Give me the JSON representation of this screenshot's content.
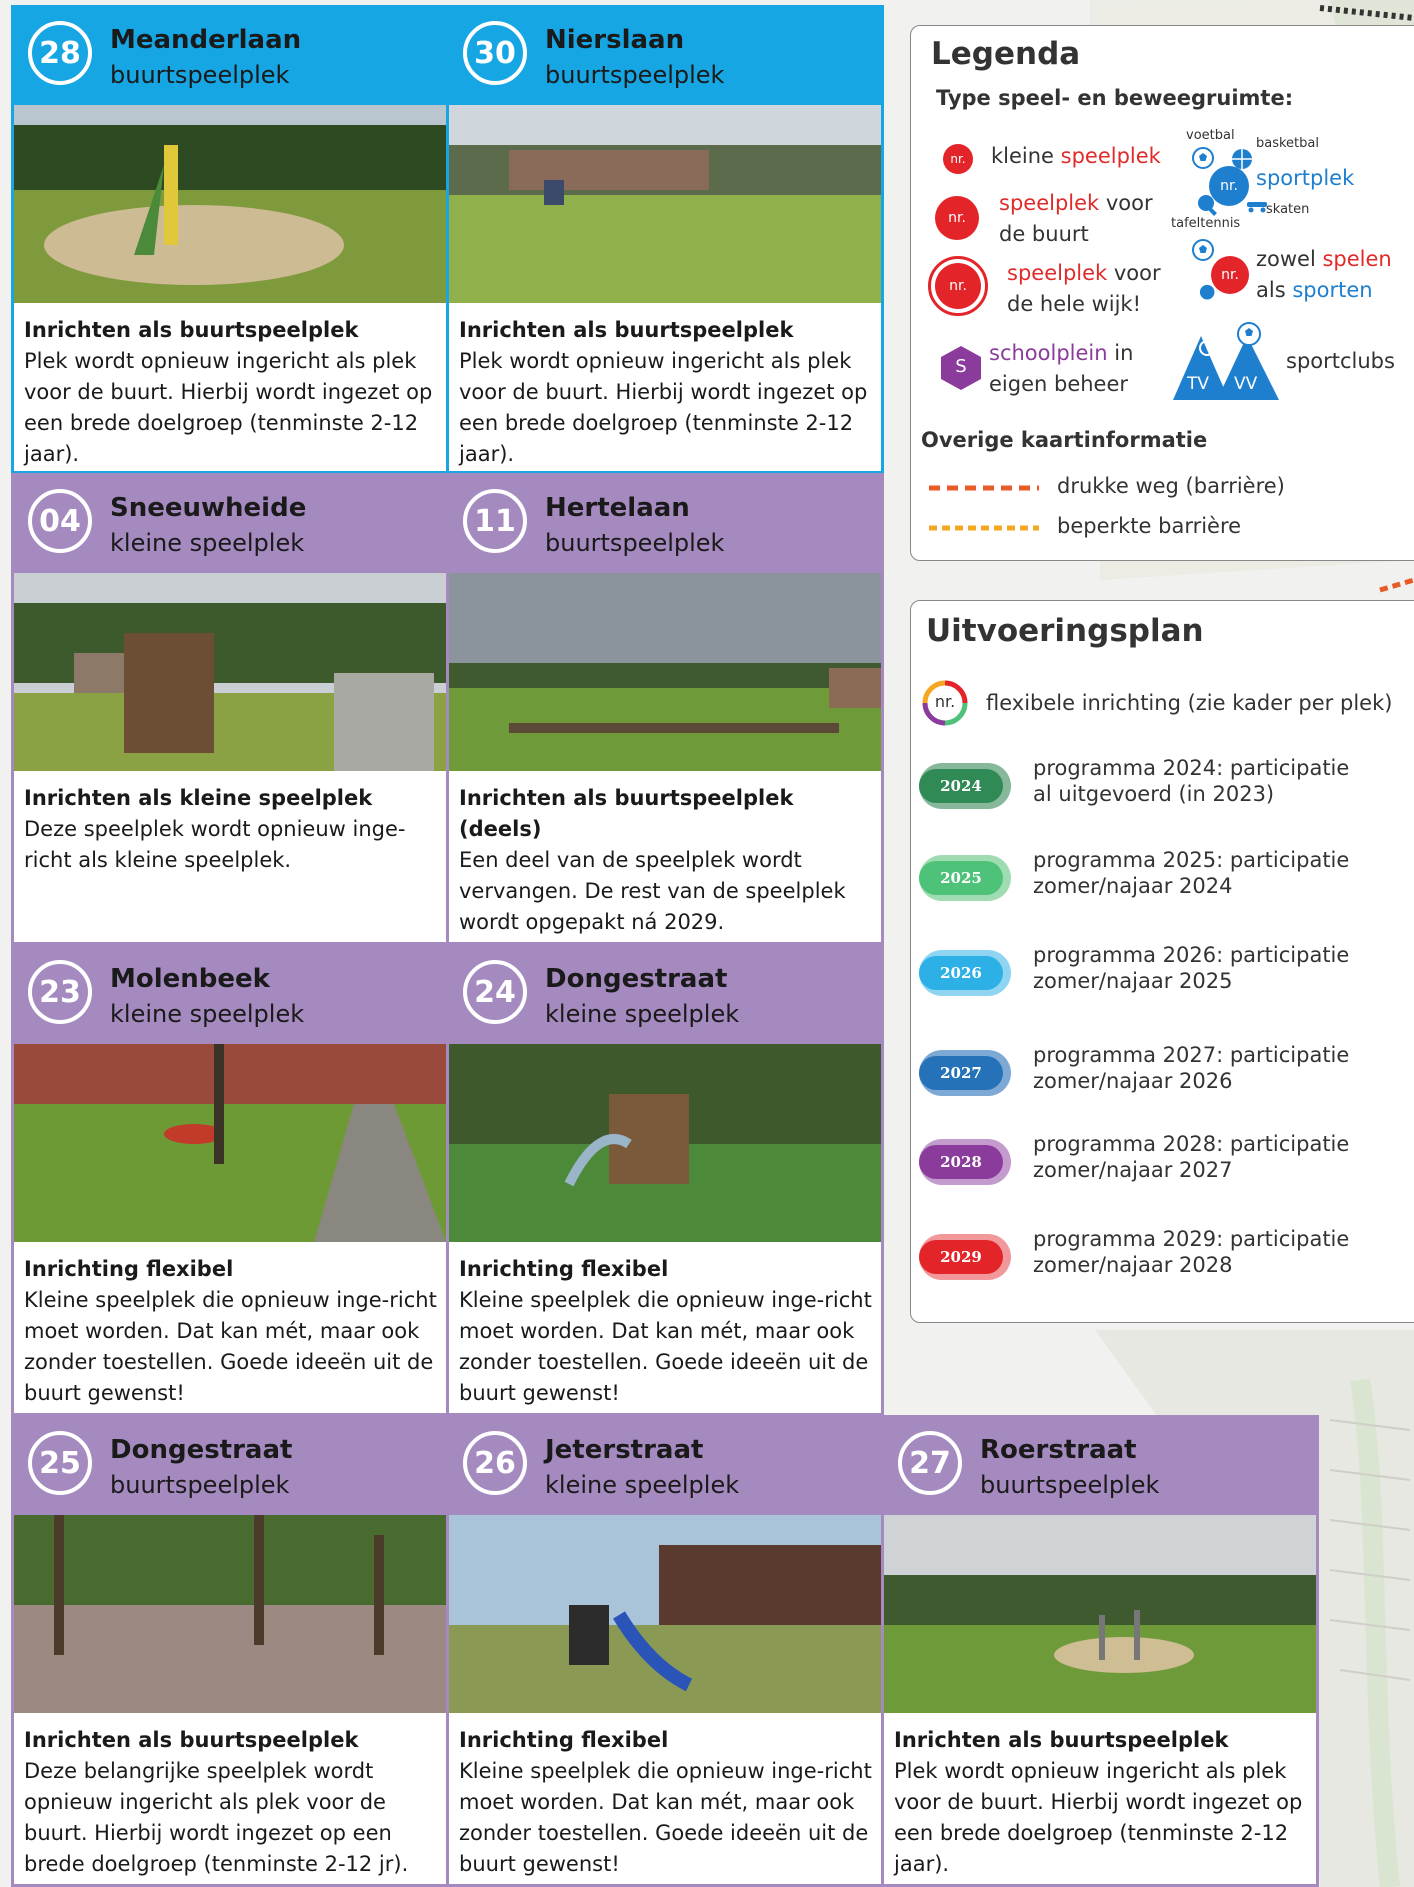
{
  "cards": [
    {
      "num": "28",
      "name": "Meanderlaan",
      "type": "buurtspeelplek",
      "heading": "Inrichten als buurtspeelplek",
      "body": "Plek wordt opnieuw ingericht als plek voor de buurt. Hierbij wordt ingezet op een brede doelgroep (tenminste 2-12 jaar)."
    },
    {
      "num": "30",
      "name": "Nierslaan",
      "type": "buurtspeelplek",
      "heading": "Inrichten als buurtspeelplek",
      "body": "Plek wordt opnieuw ingericht als plek voor de buurt. Hierbij wordt ingezet op een brede doelgroep (tenminste 2-12 jaar)."
    },
    {
      "num": "04",
      "name": "Sneeuwheide",
      "type": "kleine speelplek",
      "heading": "Inrichten als kleine speelplek",
      "body": "Deze speelplek wordt opnieuw inge-richt als kleine speelplek."
    },
    {
      "num": "11",
      "name": "Hertelaan",
      "type": "buurtspeelplek",
      "heading": "Inrichten als buurtspeelplek (deels)",
      "body": "Een deel van de speelplek wordt vervangen. De rest van de speelplek wordt opgepakt ná 2029."
    },
    {
      "num": "23",
      "name": "Molenbeek",
      "type": "kleine speelplek",
      "heading": "Inrichting flexibel",
      "body": "Kleine speelplek die opnieuw inge-richt moet worden. Dat kan mét, maar ook zonder toestellen. Goede ideeën uit de buurt gewenst!"
    },
    {
      "num": "24",
      "name": "Dongestraat",
      "type": "kleine speelplek",
      "heading": "Inrichting flexibel",
      "body": "Kleine speelplek die opnieuw inge-richt moet worden. Dat kan mét, maar ook zonder toestellen. Goede ideeën uit de buurt gewenst!"
    },
    {
      "num": "25",
      "name": "Dongestraat",
      "type": "buurtspeelplek",
      "heading": "Inrichten als buurtspeelplek",
      "body": "Deze belangrijke speelplek wordt opnieuw ingericht als plek voor de buurt. Hierbij wordt ingezet op een brede doelgroep (tenminste 2-12 jr)."
    },
    {
      "num": "26",
      "name": "Jeterstraat",
      "type": "kleine speelplek",
      "heading": "Inrichting flexibel",
      "body": "Kleine speelplek die opnieuw inge-richt moet worden. Dat kan mét, maar ook zonder toestellen. Goede ideeën uit de buurt gewenst!"
    },
    {
      "num": "27",
      "name": "Roerstraat",
      "type": "buurtspeelplek",
      "heading": "Inrichten als buurtspeelplek",
      "body": "Plek wordt opnieuw ingericht als plek voor de buurt. Hierbij wordt ingezet op een brede doelgroep (tenminste 2-12 jaar)."
    }
  ],
  "colors": {
    "blue": "#16a6e4",
    "purple": "#a58ac0",
    "red": "#e3252a"
  },
  "legend": {
    "title": "Legenda",
    "subtitle": "Type speel- en beweegruimte:",
    "nr": "nr.",
    "small_red": "speelplek",
    "small_pre": "kleine ",
    "buurt_red": "speelplek",
    "buurt_rest": " voor",
    "buurt_line2": "de buurt",
    "wijk_red": "speelplek",
    "wijk_rest": " voor",
    "wijk_line2": "de hele wijk!",
    "school_sym": "S",
    "school_purple": "schoolplein",
    "school_rest": " in",
    "school_line2": "eigen beheer",
    "voetbal": "voetbal",
    "basketbal": "basketbal",
    "tafeltennis": "tafeltennis",
    "skaten": "skaten",
    "sportplek": "sportplek",
    "both_pre": "zowel ",
    "both_red": "spelen",
    "both_line2_pre": "als ",
    "both_blue": "sporten",
    "tv": "TV",
    "vv": "VV",
    "sportclubs": "sportclubs",
    "other_title": "Overige kaartinformatie",
    "road1": "drukke weg (barrière)",
    "road2": "beperkte barrière"
  },
  "plan": {
    "title": "Uitvoeringsplan",
    "flex": "flexibele inrichting (zie kader per plek)",
    "items": [
      {
        "year": "2024",
        "line1": "programma 2024: participatie",
        "line2": "al uitgevoerd (in 2023)",
        "color": "#2f8a56",
        "tail": "#87b89b"
      },
      {
        "year": "2025",
        "line1": "programma 2025: participatie",
        "line2": "zomer/najaar 2024",
        "color": "#4fc27a",
        "tail": "#9fdcb2"
      },
      {
        "year": "2026",
        "line1": "programma 2026: participatie",
        "line2": "zomer/najaar 2025",
        "color": "#2cb0e6",
        "tail": "#8fd5f2"
      },
      {
        "year": "2027",
        "line1": "programma 2027: participatie",
        "line2": "zomer/najaar 2026",
        "color": "#2672b8",
        "tail": "#7ea9d5"
      },
      {
        "year": "2028",
        "line1": "programma 2028: participatie",
        "line2": "zomer/najaar 2027",
        "color": "#8b3b9b",
        "tail": "#c49bcd"
      },
      {
        "year": "2029",
        "line1": "programma 2029: participatie",
        "line2": "zomer/najaar 2028",
        "color": "#e3252a",
        "tail": "#f2979a"
      }
    ]
  }
}
